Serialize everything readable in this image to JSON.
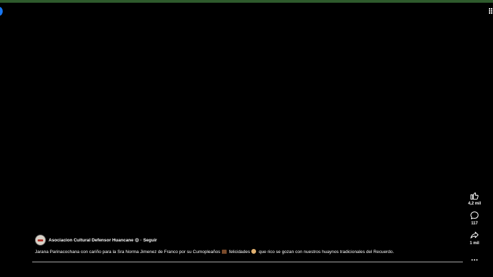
{
  "actions": {
    "like": {
      "icon": "thumbs-up-icon",
      "count": "4,2 mil"
    },
    "comment": {
      "icon": "comment-icon",
      "count": "117"
    },
    "share": {
      "icon": "share-icon",
      "count": "1 mil"
    },
    "more": {
      "icon": "more-horizontal-icon"
    }
  },
  "post": {
    "channel_name": "Asociacion Cultural Defensor Huancane",
    "separator": "·",
    "follow_label": "Seguir",
    "caption_part1": "Jarana Parinacochana con cariño para la Sra Norma Jimenez de Franco por su Cumopleaños",
    "caption_part2": "felicidades",
    "caption_part3": "que rico se gozan con nuestros huaynos tradicionales del Recuerdo."
  },
  "player": {
    "progress": 0
  },
  "colors": {
    "background": "#000000",
    "top_strip": "#2e5a2c",
    "accent_blue": "#1877f2",
    "progress_track": "#5a5a5a"
  }
}
